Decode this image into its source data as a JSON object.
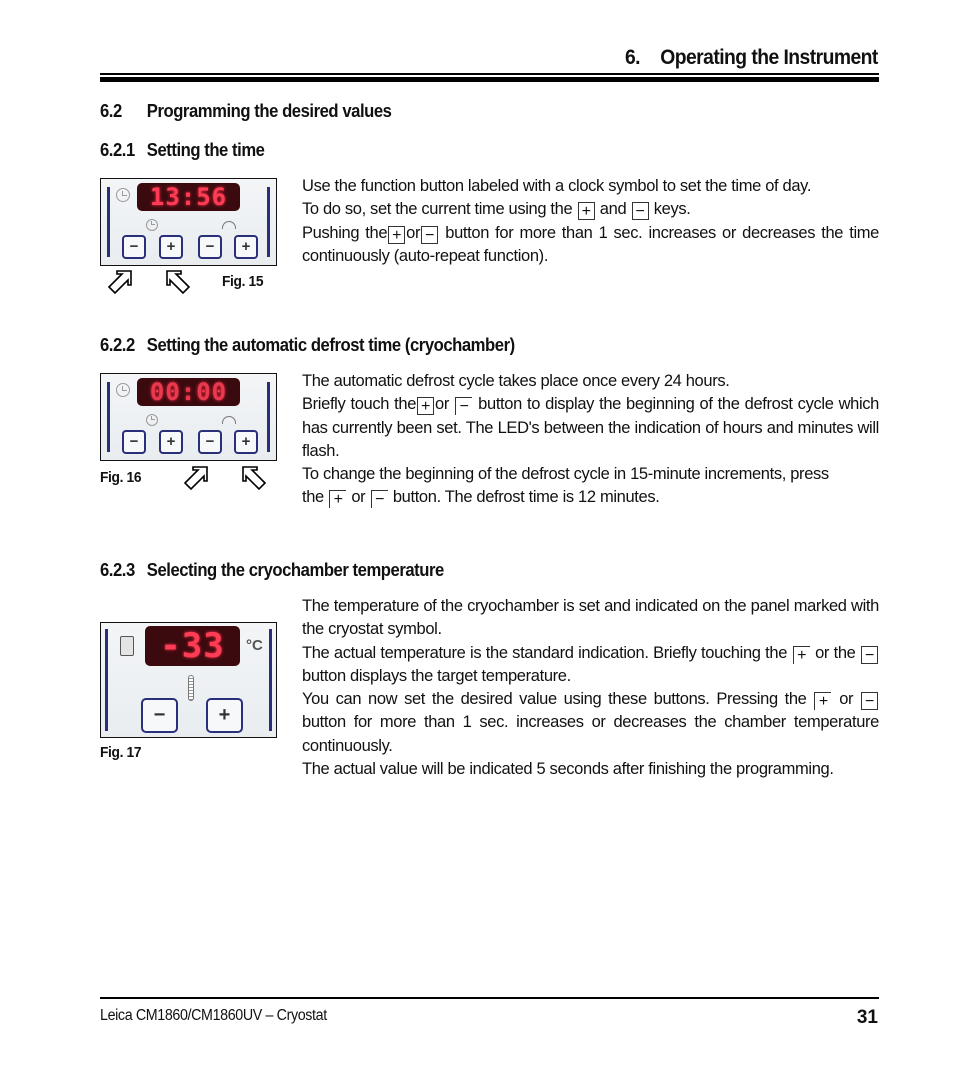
{
  "header": {
    "chapter_number": "6.",
    "chapter_title": "Operating the Instrument"
  },
  "section_6_2": {
    "number": "6.2",
    "title": "Programming the desired values"
  },
  "section_6_2_1": {
    "number": "6.2.1",
    "title": "Setting the time",
    "figure": {
      "label": "Fig. 15",
      "display_value": "13:56",
      "buttons": [
        "−",
        "+",
        "−",
        "+"
      ]
    },
    "text": {
      "p1": "Use the function button labeled with a clock symbol to set the time of day.",
      "p2_a": "To do so, set the current time using the",
      "p2_b": "and",
      "p2_c": "keys.",
      "p3_a": "Pushing the",
      "p3_b": "or",
      "p3_c": "button for more than 1 sec. increases or decreases the time continuously (auto-repeat function)."
    }
  },
  "section_6_2_2": {
    "number": "6.2.2",
    "title": "Setting the automatic defrost time (cryochamber)",
    "figure": {
      "label": "Fig. 16",
      "display_value": "00:00",
      "buttons": [
        "−",
        "+",
        "−",
        "+"
      ]
    },
    "text": {
      "p1": "The automatic defrost cycle takes place once every 24 hours.",
      "p2_a": "Briefly touch the",
      "p2_b": "or",
      "p2_c": "button to display the beginning of the defrost cycle which has currently been set. The LED's between the indication of hours and minutes will flash.",
      "p3": "To change the beginning of the defrost cycle in 15-minute increments, press",
      "p4_a": "the",
      "p4_b": "or",
      "p4_c": "button. The defrost time is 12 minutes."
    }
  },
  "section_6_2_3": {
    "number": "6.2.3",
    "title": "Selecting the cryochamber temperature",
    "figure": {
      "label": "Fig. 17",
      "display_value": "-33",
      "unit": "°C",
      "buttons": [
        "−",
        "+"
      ]
    },
    "text": {
      "p1": "The temperature of the cryochamber is set and indicated on the panel marked with the cryostat symbol.",
      "p2_a": "The actual temperature is the standard indication. Briefly touching the",
      "p2_b": "or the",
      "p2_c": "button displays the target temperature.",
      "p3_a": "You can now set the desired value using these buttons. Pressing the",
      "p3_b": "or",
      "p3_c": "button for more than 1 sec. increases or decreases the chamber temperature continuously.",
      "p4": "The actual value will be indicated 5 seconds after finishing the programming."
    }
  },
  "keys": {
    "plus": "+",
    "minus": "−"
  },
  "footer": {
    "product": "Leica CM1860/CM1860UV – Cryostat",
    "page_number": "31"
  }
}
